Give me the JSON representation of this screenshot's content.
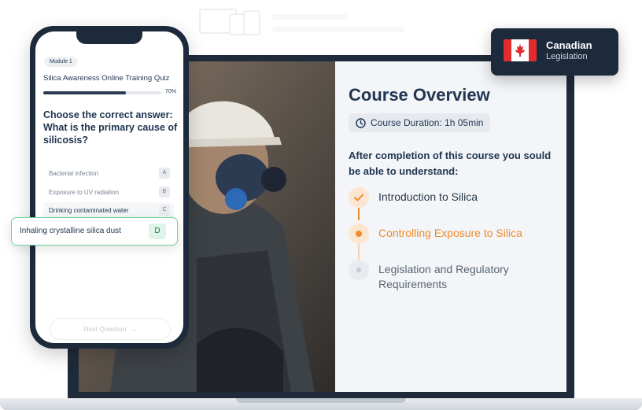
{
  "top_hint": {
    "devices_icon": "devices-icon"
  },
  "badge": {
    "title": "Canadian",
    "subtitle": "Legislation",
    "flag_icon": "canada-flag-icon"
  },
  "overview": {
    "title": "Course Overview",
    "duration_label": "Course Duration: 1h 05min",
    "clock_icon": "clock-icon",
    "intro_text": "After completion of this course you sould be able to understand:",
    "steps": [
      {
        "label": "Introduction to Silica",
        "state": "completed"
      },
      {
        "label": "Controlling Exposure to Silica",
        "state": "current"
      },
      {
        "label": "Legislation and Regulatory Requirements",
        "state": "upcoming"
      }
    ]
  },
  "quiz": {
    "module": "Module 1",
    "title": "Silica Awareness Online Training Quiz",
    "progress": 0.7,
    "progress_label": "70%",
    "question": "Choose the correct answer: What is the primary cause of silicosis?",
    "answers": [
      {
        "text": "Bacterial infection",
        "letter": "A"
      },
      {
        "text": "Exposure to UV radiation",
        "letter": "B"
      },
      {
        "text": "Drinking contaminated water",
        "letter": "C"
      }
    ],
    "selected_answer": {
      "text": "Inhaling crystalline silica dust",
      "letter": "D"
    },
    "next_button": "Next Question"
  },
  "colors": {
    "accent": "#ee8c2a",
    "success": "#6ed39c",
    "navy": "#1f3550"
  }
}
